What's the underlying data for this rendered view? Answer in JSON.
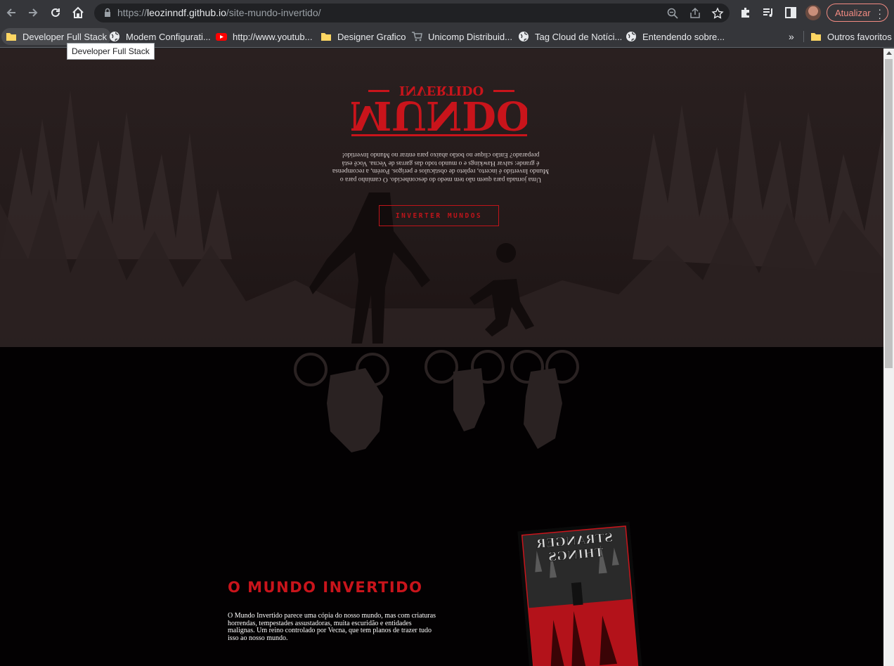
{
  "browser": {
    "url_prefix": "https://",
    "url_host": "leozinndf.github.io",
    "url_path": "/site-mundo-invertido/",
    "update_label": "Atualizar",
    "more_bookmarks": "»",
    "other_bookmarks": "Outros favoritos",
    "tooltip": "Developer Full Stack"
  },
  "bookmarks": [
    {
      "label": "Developer Full Stack",
      "icon": "folder-icon"
    },
    {
      "label": "Modem Configurati...",
      "icon": "globe-icon"
    },
    {
      "label": "http://www.youtub...",
      "icon": "youtube-icon"
    },
    {
      "label": "Designer Grafico",
      "icon": "folder-icon"
    },
    {
      "label": "Unicomp Distribuid...",
      "icon": "cart-icon"
    },
    {
      "label": "Tag Cloud de Notíci...",
      "icon": "globe-icon"
    },
    {
      "label": "Entendendo sobre...",
      "icon": "globe-icon"
    }
  ],
  "hero": {
    "logo_top": "INVERTIDO",
    "logo_main": "MUNDO",
    "text": "Uma jornada para quem não tem medo do desconhecido. O caminho para o Mundo Invertido é incerto, repleto de obstáculos e perigos. Porém, a recompensa é grande: salvar Hawkings e o mundo todo das garras de Vecna. Você está preparado? Então clique no botão abaixo para entrar no Mundo Invertido!",
    "button_label": "INVERTER MUNDOS"
  },
  "section": {
    "title": "O MUNDO INVERTIDO",
    "body": "O Mundo Invertido parece uma cópia do nosso mundo, mas com criaturas horrendas, tempestades assustadoras, muita escuridão e entidades malignas. Um reino controlado por Vecna, que tem planos de trazer tudo isso ao nosso mundo."
  },
  "poster": {
    "title_line1": "STRANGER",
    "title_line2": "THINGS"
  },
  "colors": {
    "accent_red": "#c9141b",
    "chrome_bg": "#35363a",
    "update_red": "#f28b82"
  }
}
